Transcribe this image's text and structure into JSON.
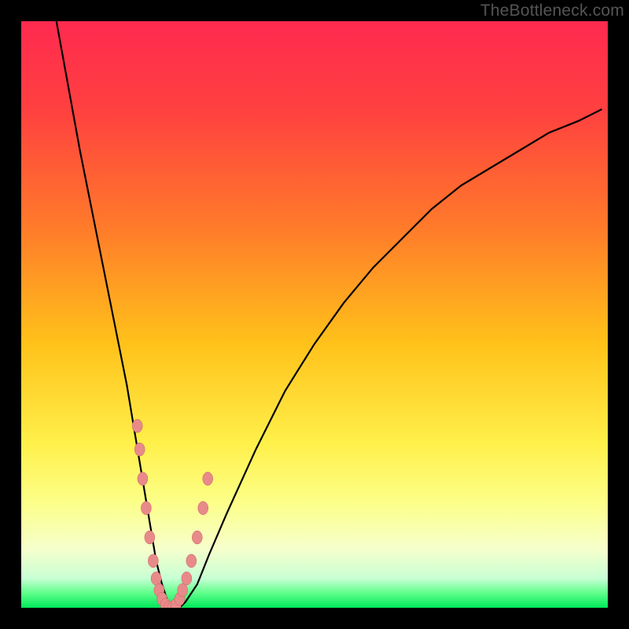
{
  "watermark": "TheBottleneck.com",
  "colors": {
    "bg": "#000000",
    "gradient_stops": [
      {
        "offset": 0.0,
        "color": "#ff2a4f"
      },
      {
        "offset": 0.15,
        "color": "#ff4040"
      },
      {
        "offset": 0.35,
        "color": "#ff7a2a"
      },
      {
        "offset": 0.55,
        "color": "#ffc21a"
      },
      {
        "offset": 0.72,
        "color": "#fff04a"
      },
      {
        "offset": 0.82,
        "color": "#fcff88"
      },
      {
        "offset": 0.9,
        "color": "#f6ffcc"
      },
      {
        "offset": 0.95,
        "color": "#c8ffd4"
      },
      {
        "offset": 0.975,
        "color": "#5fff8a"
      },
      {
        "offset": 1.0,
        "color": "#00e85a"
      }
    ],
    "curve": "#000000",
    "marker_fill": "#e88a8a",
    "marker_stroke": "#c86060"
  },
  "chart_data": {
    "type": "line",
    "title": "",
    "xlabel": "",
    "ylabel": "",
    "xlim": [
      0,
      100
    ],
    "ylim": [
      0,
      100
    ],
    "grid": false,
    "legend": false,
    "series": [
      {
        "name": "bottleneck-curve",
        "x": [
          6,
          8,
          10,
          12,
          14,
          16,
          18,
          19,
          20,
          21,
          22,
          23,
          24,
          25,
          26,
          27,
          28,
          30,
          32,
          35,
          40,
          45,
          50,
          55,
          60,
          65,
          70,
          75,
          80,
          85,
          90,
          95,
          99
        ],
        "y": [
          100,
          89,
          78,
          68,
          58,
          48,
          38,
          32,
          26,
          20,
          14,
          8,
          4,
          1,
          0,
          0,
          1,
          4,
          9,
          16,
          27,
          37,
          45,
          52,
          58,
          63,
          68,
          72,
          75,
          78,
          81,
          83,
          85
        ]
      }
    ],
    "markers": {
      "name": "overlay-points",
      "x_ranges": [
        [
          19.5,
          23.5
        ],
        [
          27.0,
          31.5
        ]
      ],
      "points": [
        {
          "x": 19.8,
          "y": 31
        },
        {
          "x": 20.2,
          "y": 27
        },
        {
          "x": 20.7,
          "y": 22
        },
        {
          "x": 21.3,
          "y": 17
        },
        {
          "x": 21.9,
          "y": 12
        },
        {
          "x": 22.5,
          "y": 8
        },
        {
          "x": 23.0,
          "y": 5
        },
        {
          "x": 23.5,
          "y": 3
        },
        {
          "x": 24.0,
          "y": 1.5
        },
        {
          "x": 24.6,
          "y": 0.5
        },
        {
          "x": 25.2,
          "y": 0
        },
        {
          "x": 25.8,
          "y": 0
        },
        {
          "x": 26.4,
          "y": 0.5
        },
        {
          "x": 27.0,
          "y": 1.5
        },
        {
          "x": 27.5,
          "y": 3
        },
        {
          "x": 28.2,
          "y": 5
        },
        {
          "x": 29.0,
          "y": 8
        },
        {
          "x": 30.0,
          "y": 12
        },
        {
          "x": 31.0,
          "y": 17
        },
        {
          "x": 31.8,
          "y": 22
        }
      ]
    }
  }
}
